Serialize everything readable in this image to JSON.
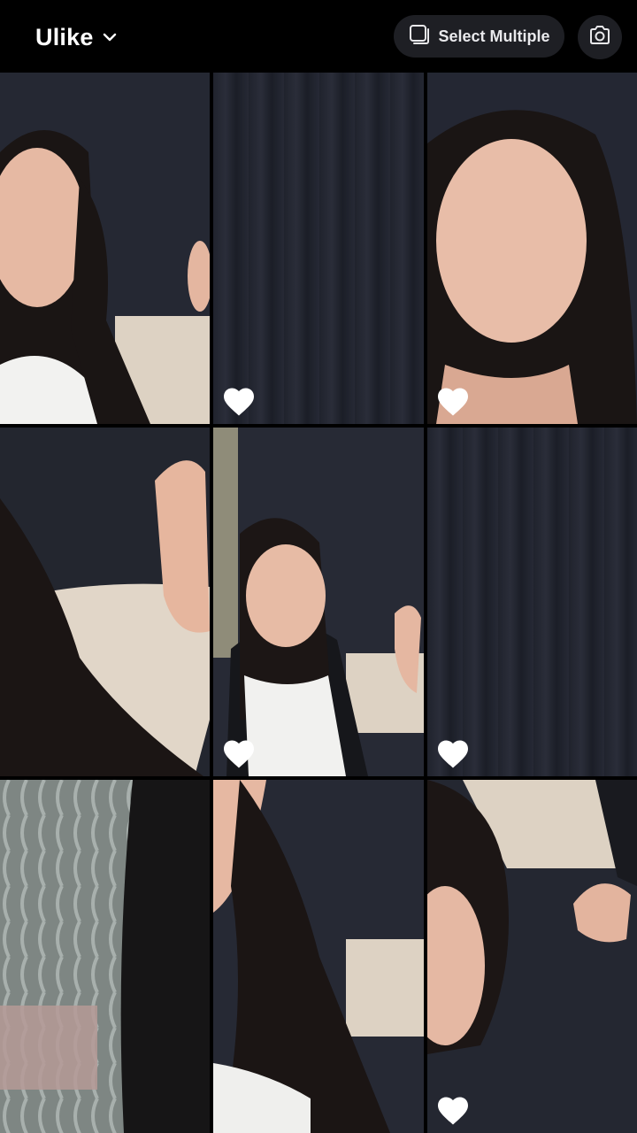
{
  "header": {
    "album_title": "Ulike",
    "select_label": "Select Multiple"
  },
  "icons": {
    "album_dropdown": "chevron-down-icon",
    "select": "select-multiple-icon",
    "camera": "camera-icon",
    "favorite": "heart-icon"
  },
  "colors": {
    "background": "#000000",
    "button_bg": "#1e1f24",
    "text": "#ffffff",
    "heart": "#ffffff"
  },
  "media_grid": {
    "columns": 3,
    "items": [
      {
        "favorite": false
      },
      {
        "favorite": true
      },
      {
        "favorite": true
      },
      {
        "favorite": false
      },
      {
        "favorite": true
      },
      {
        "favorite": true
      },
      {
        "favorite": false
      },
      {
        "favorite": false
      },
      {
        "favorite": true
      }
    ]
  }
}
